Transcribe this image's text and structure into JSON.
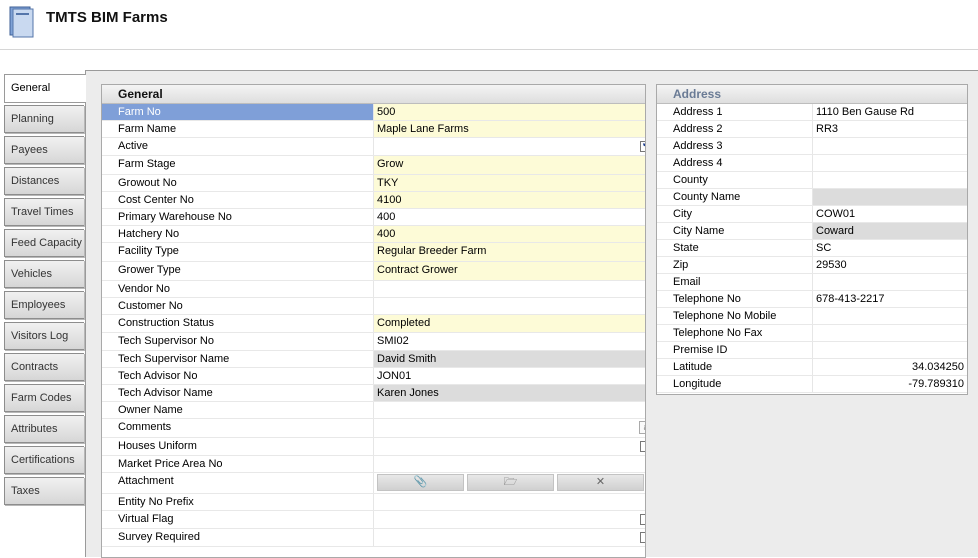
{
  "app": {
    "title": "TMTS BIM Farms",
    "icon": "farm-app-icon"
  },
  "tabs": [
    "General",
    "Planning",
    "Payees",
    "Distances",
    "Travel Times",
    "Feed Capacity",
    "Vehicles",
    "Employees",
    "Visitors Log",
    "Contracts",
    "Farm Codes",
    "Attributes",
    "Certifications",
    "Taxes"
  ],
  "active_tab": "General",
  "general": {
    "title": "General",
    "fields": [
      {
        "label": "Farm No",
        "value": "500",
        "style": "y",
        "selected": true
      },
      {
        "label": "Farm Name",
        "value": "Maple Lane Farms",
        "style": "y"
      },
      {
        "label": "Active",
        "value": "",
        "checkbox": true,
        "checked": true
      },
      {
        "label": "Farm Stage",
        "value": "Grow",
        "style": "y"
      },
      {
        "label": "Growout No",
        "value": "TKY",
        "style": "y"
      },
      {
        "label": "Cost Center No",
        "value": "4100",
        "style": "y"
      },
      {
        "label": "Primary Warehouse No",
        "value": "400"
      },
      {
        "label": "Hatchery No",
        "value": "400",
        "style": "y"
      },
      {
        "label": "Facility Type",
        "value": "Regular Breeder Farm",
        "style": "y"
      },
      {
        "label": "Grower Type",
        "value": "Contract Grower",
        "style": "y"
      },
      {
        "label": "Vendor No",
        "value": ""
      },
      {
        "label": "Customer No",
        "value": ""
      },
      {
        "label": "Construction Status",
        "value": "Completed",
        "style": "y"
      },
      {
        "label": "Tech Supervisor No",
        "value": "SMI02"
      },
      {
        "label": "Tech Supervisor Name",
        "value": "David Smith",
        "style": "g"
      },
      {
        "label": "Tech Advisor No",
        "value": "JON01"
      },
      {
        "label": "Tech Advisor Name",
        "value": "Karen Jones",
        "style": "g"
      },
      {
        "label": "Owner Name",
        "value": ""
      },
      {
        "label": "Comments",
        "value": "",
        "memo": true
      },
      {
        "label": "Houses Uniform",
        "value": "",
        "checkbox": true,
        "checked": false
      },
      {
        "label": "Market Price Area No",
        "value": ""
      },
      {
        "label": "Attachment",
        "value": "",
        "attachment": true
      },
      {
        "label": "Entity No Prefix",
        "value": ""
      },
      {
        "label": "Virtual Flag",
        "value": "",
        "checkbox": true,
        "checked": false
      },
      {
        "label": "Survey Required",
        "value": "",
        "checkbox": true,
        "checked": false
      }
    ],
    "attachment_buttons": [
      {
        "icon": "paperclip-icon",
        "glyph": "📎"
      },
      {
        "icon": "open-folder-icon",
        "glyph": "🗁"
      },
      {
        "icon": "close-icon",
        "glyph": "✕"
      }
    ]
  },
  "address": {
    "title": "Address",
    "fields": [
      {
        "label": "Address 1",
        "value": "1110 Ben Gause Rd"
      },
      {
        "label": "Address 2",
        "value": "RR3"
      },
      {
        "label": "Address 3",
        "value": ""
      },
      {
        "label": "Address 4",
        "value": ""
      },
      {
        "label": "County",
        "value": ""
      },
      {
        "label": "County Name",
        "value": "",
        "style": "g"
      },
      {
        "label": "City",
        "value": "COW01"
      },
      {
        "label": "City Name",
        "value": "Coward",
        "style": "g"
      },
      {
        "label": "State",
        "value": "SC"
      },
      {
        "label": "Zip",
        "value": "29530"
      },
      {
        "label": "Email",
        "value": ""
      },
      {
        "label": "Telephone No",
        "value": "678-413-2217"
      },
      {
        "label": "Telephone No Mobile",
        "value": ""
      },
      {
        "label": "Telephone No Fax",
        "value": ""
      },
      {
        "label": "Premise ID",
        "value": ""
      },
      {
        "label": "Latitude",
        "value": "34.034250",
        "numeric": true
      },
      {
        "label": "Longitude",
        "value": "-79.789310",
        "numeric": true
      }
    ]
  },
  "colors": {
    "required": "#fdfbd7",
    "readonly": "#dcdcdc",
    "selected": "#7f9fd8"
  }
}
